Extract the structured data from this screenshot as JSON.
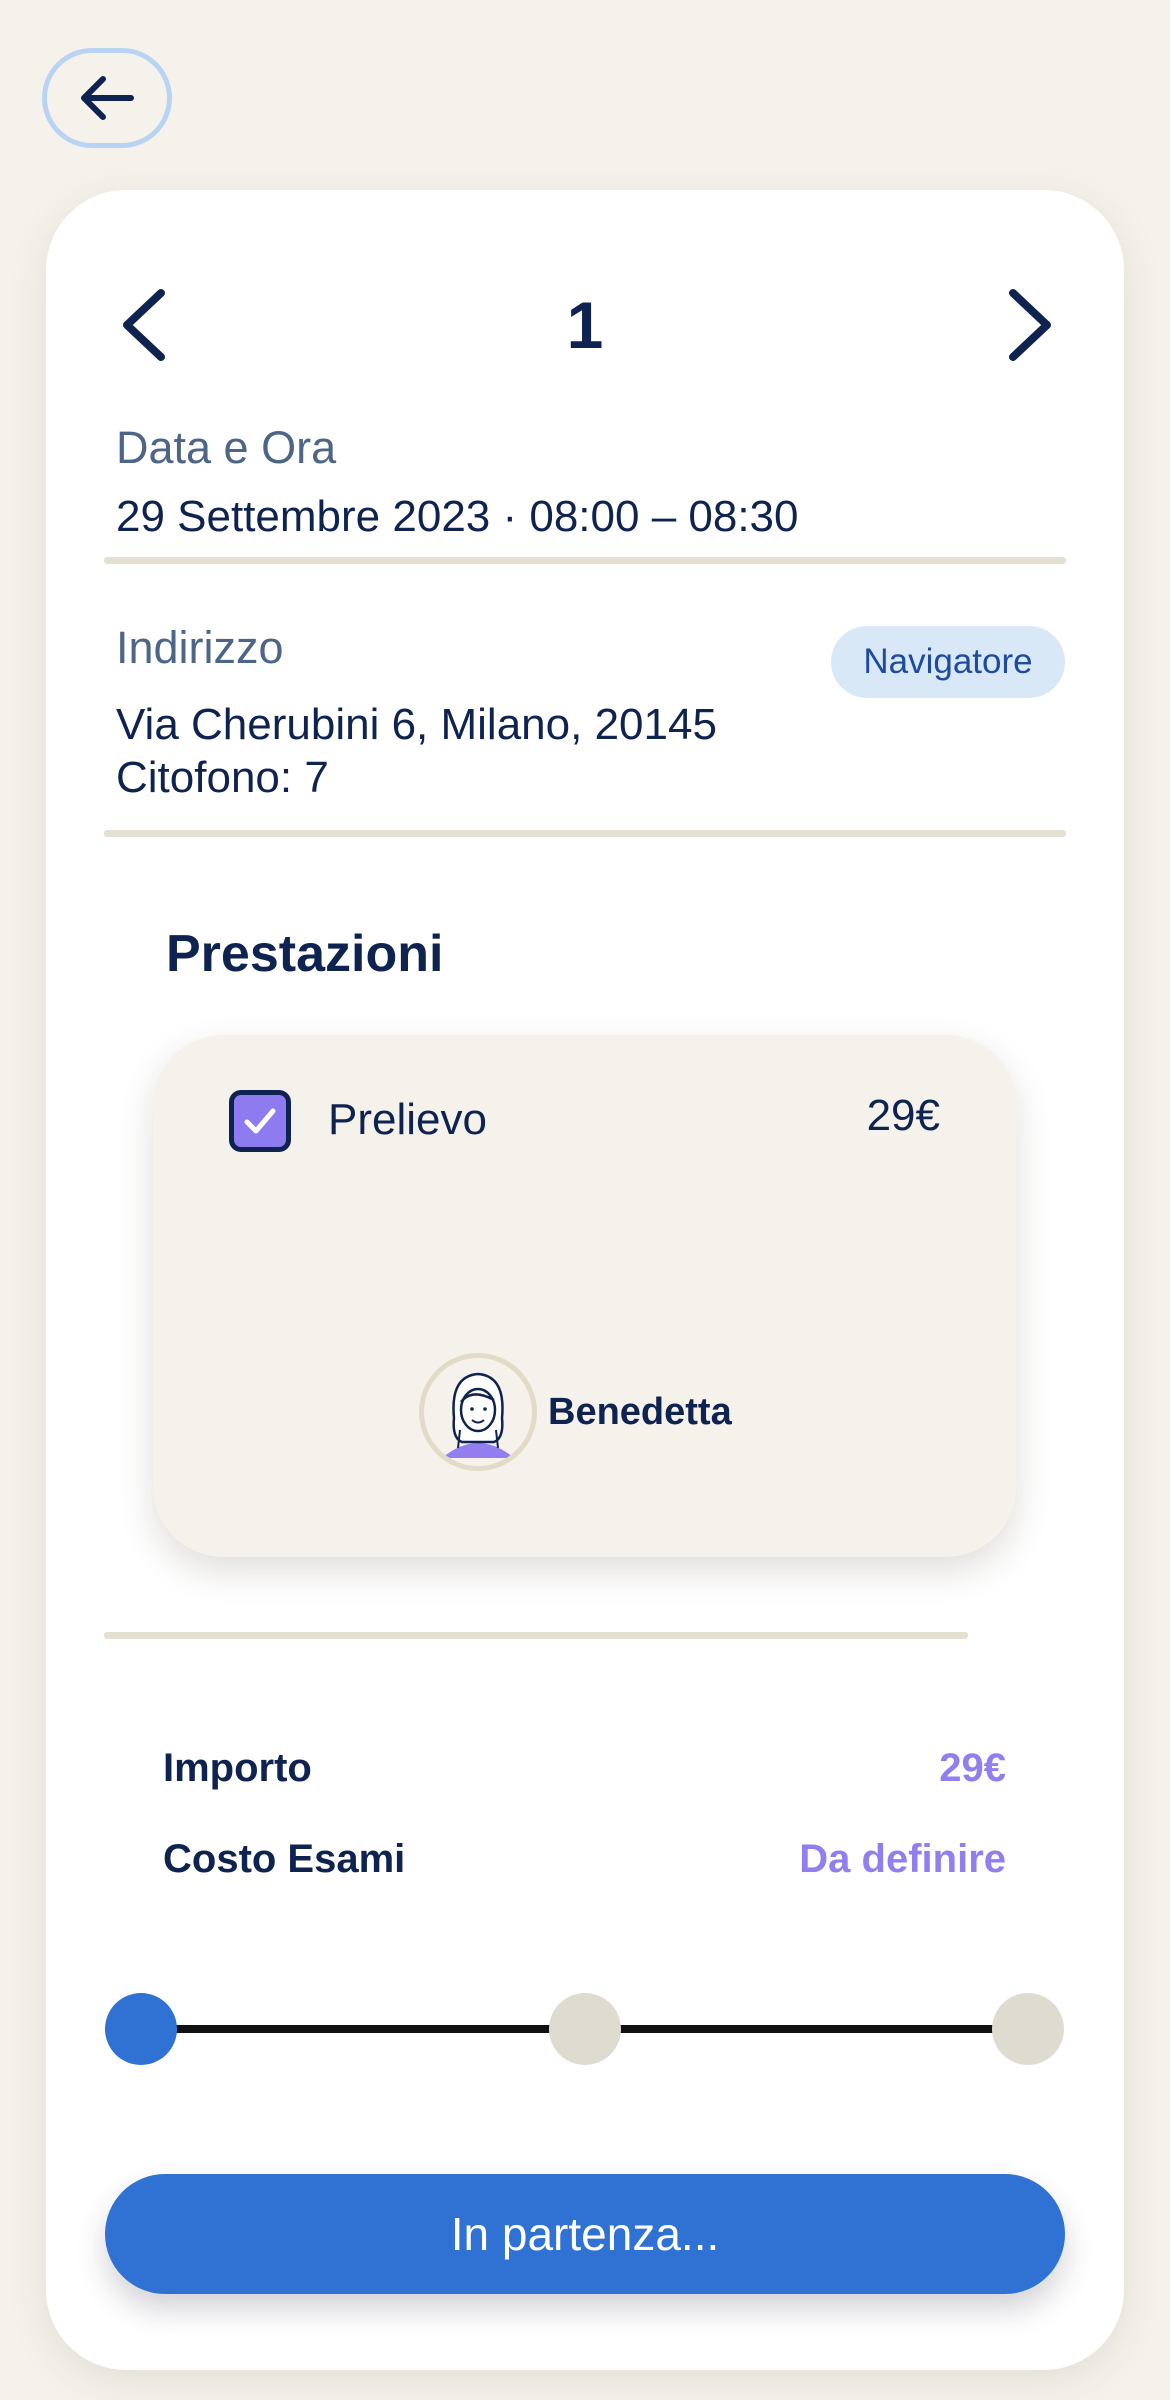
{
  "header": {
    "back_icon": "arrow-left-icon"
  },
  "pager": {
    "current": "1",
    "prev_icon": "chevron-left-icon",
    "next_icon": "chevron-right-icon"
  },
  "appointment": {
    "datetime_label": "Data e Ora",
    "datetime_value": "29 Settembre 2023 · 08:00 – 08:30",
    "address_label": "Indirizzo",
    "navigator_button": "Navigatore",
    "address_line1": "Via Cherubini 6, Milano, 20145",
    "address_line2": "Citofono: 7"
  },
  "services": {
    "title": "Prestazioni",
    "items": [
      {
        "name": "Prelievo",
        "price": "29€",
        "checked": true
      }
    ],
    "operator": {
      "name": "Benedetta"
    }
  },
  "summary": {
    "amount_label": "Importo",
    "amount_value": "29€",
    "exam_cost_label": "Costo Esami",
    "exam_cost_value": "Da definire"
  },
  "progress": {
    "total_steps": 3,
    "current_step": 1
  },
  "cta": {
    "label": "In partenza..."
  },
  "colors": {
    "primary": "#2f72d3",
    "accent": "#937ef0",
    "navy": "#0f2350",
    "background": "#f5f2ec",
    "step_inactive": "#dedbd0"
  }
}
